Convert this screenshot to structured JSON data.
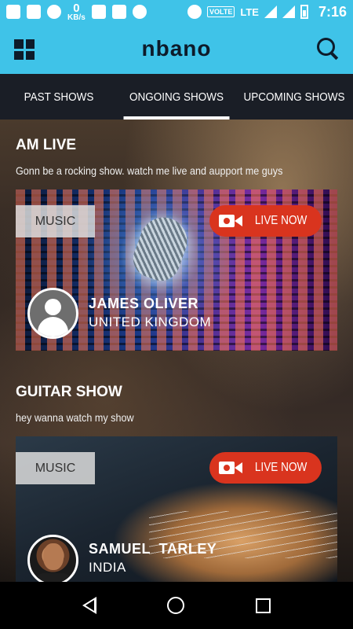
{
  "status_bar": {
    "speed_value": "0",
    "speed_unit": "KB/s",
    "volte": "VOLTE",
    "network": "LTE",
    "time": "7:16"
  },
  "app": {
    "logo": "nbano"
  },
  "tabs": [
    {
      "label": "PAST SHOWS",
      "active": false
    },
    {
      "label": "ONGOING SHOWS",
      "active": true
    },
    {
      "label": "UPCOMING SHOWS",
      "active": false
    }
  ],
  "shows": [
    {
      "title": "AM LIVE",
      "description": "Gonn be a rocking show. watch me live and aupport me guys",
      "category": "MUSIC",
      "live_label": "LIVE NOW",
      "host_name": "JAMES OLIVER",
      "host_country": "UNITED KINGDOM"
    },
    {
      "title": "GUITAR SHOW",
      "description": "hey wanna watch my show",
      "category": "MUSIC",
      "live_label": "LIVE NOW",
      "host_name": "SAMUEL  TARLEY",
      "host_country": "INDIA"
    }
  ],
  "colors": {
    "accent": "#3fc3e8",
    "live": "#d9341e",
    "tab_bg": "#1a1e26"
  }
}
